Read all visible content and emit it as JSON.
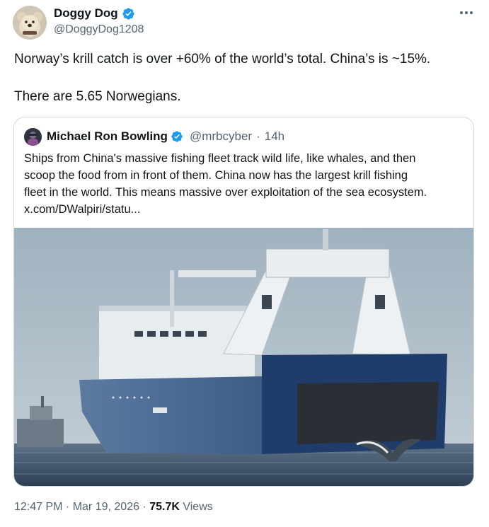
{
  "author": {
    "display_name": "Doggy Dog",
    "handle": "@DoggyDog1208",
    "verified": true
  },
  "tweet": {
    "line1": "Norway’s krill catch is over +60% of the world’s total. China’s is ~15%.",
    "line2": "There are 5.65 Norwegians."
  },
  "quoted": {
    "display_name": "Michael Ron Bowling",
    "handle": "@mrbcyber",
    "separator": "·",
    "time": "14h",
    "lines": [
      "Ships from China's massive fishing fleet track wild life, like whales, and then",
      "scoop the food from in front of them.  China now has the largest krill fishing",
      "fleet in the world.  This means massive over exploitation of the sea ecosystem.",
      "x.com/DWalpiri/statu..."
    ]
  },
  "meta": {
    "time": "12:47 PM",
    "sep1": " · ",
    "date": "Mar 19, 2026",
    "sep2": " · ",
    "views_count": "75.7K",
    "views_label": " Views"
  },
  "colors": {
    "text": "#0f1419",
    "secondary": "#536471",
    "verified": "#1d9bf0",
    "border": "#cfd9de"
  },
  "icons": {
    "verified": "verified-badge-icon",
    "more": "more-horizontal-icon"
  }
}
